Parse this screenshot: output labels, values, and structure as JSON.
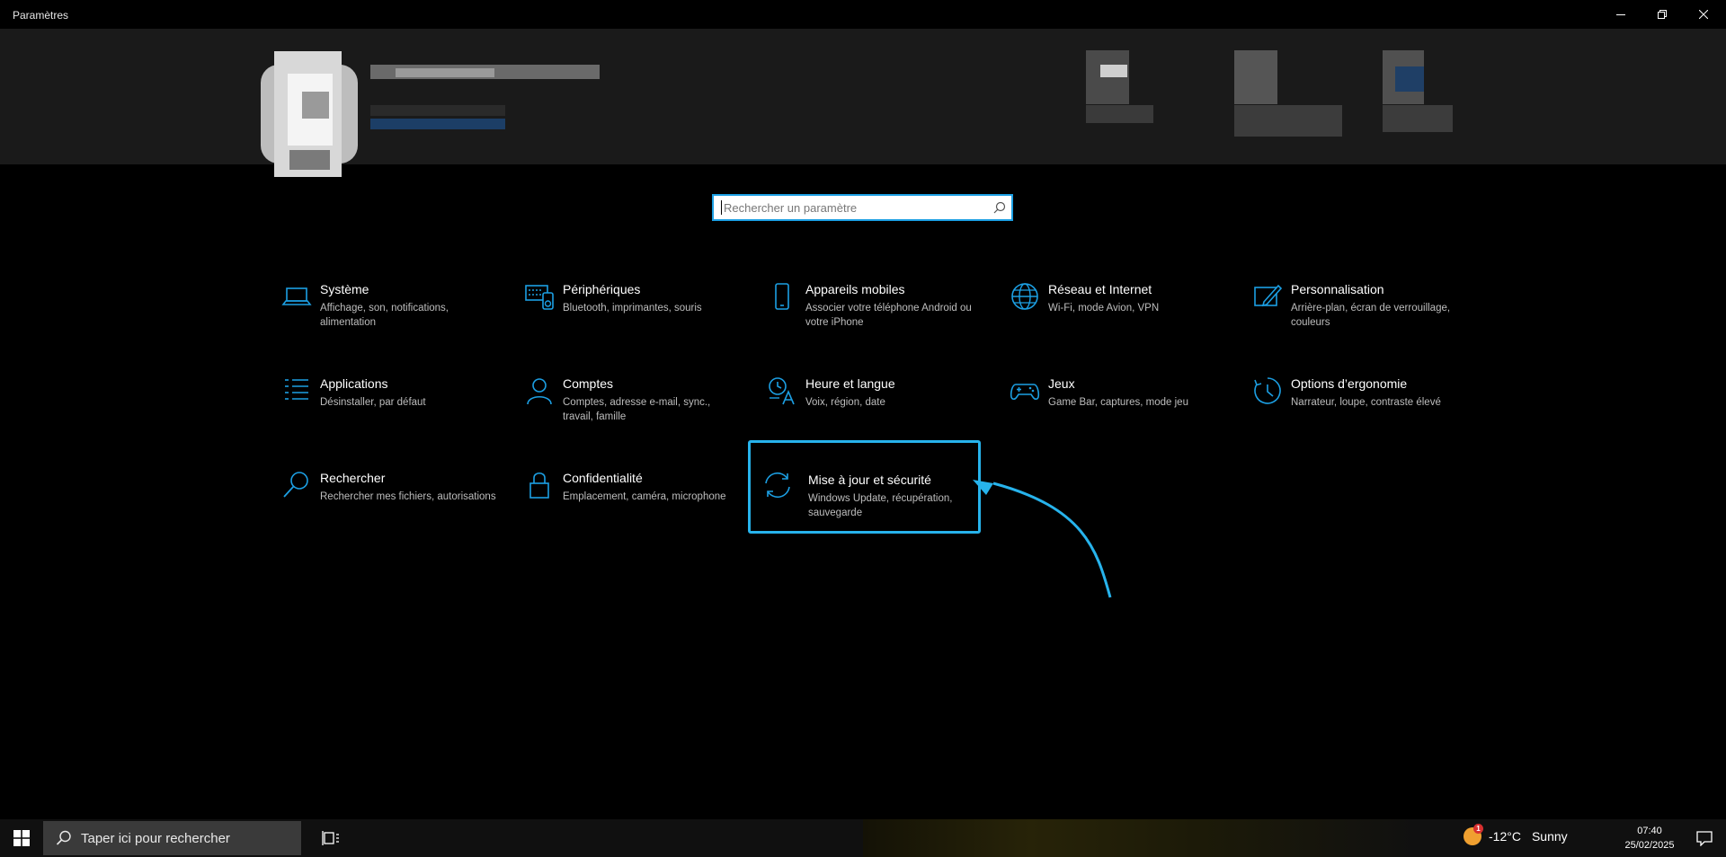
{
  "window": {
    "title": "Paramètres"
  },
  "search": {
    "placeholder": "Rechercher un paramètre"
  },
  "accent_color": "#1c9fe3",
  "highlight_color": "#27b3ec",
  "categories": [
    {
      "title": "Système",
      "desc": "Affichage, son, notifications, alimentation",
      "icon": "laptop-icon"
    },
    {
      "title": "Périphériques",
      "desc": "Bluetooth, imprimantes, souris",
      "icon": "devices-icon"
    },
    {
      "title": "Appareils mobiles",
      "desc": "Associer votre téléphone Android ou votre iPhone",
      "icon": "phone-icon"
    },
    {
      "title": "Réseau et Internet",
      "desc": "Wi-Fi, mode Avion, VPN",
      "icon": "globe-icon"
    },
    {
      "title": "Personnalisation",
      "desc": "Arrière-plan, écran de verrouillage, couleurs",
      "icon": "pen-icon"
    },
    {
      "title": "Applications",
      "desc": "Désinstaller, par défaut",
      "icon": "apps-list-icon"
    },
    {
      "title": "Comptes",
      "desc": "Comptes, adresse e-mail, sync., travail, famille",
      "icon": "person-icon"
    },
    {
      "title": "Heure et langue",
      "desc": "Voix, région, date",
      "icon": "time-language-icon"
    },
    {
      "title": "Jeux",
      "desc": "Game Bar, captures, mode jeu",
      "icon": "gamepad-icon"
    },
    {
      "title": "Options d’ergonomie",
      "desc": "Narrateur, loupe, contraste élevé",
      "icon": "ease-of-access-icon"
    },
    {
      "title": "Rechercher",
      "desc": "Rechercher mes fichiers, autorisations",
      "icon": "search-icon"
    },
    {
      "title": "Confidentialité",
      "desc": "Emplacement, caméra, microphone",
      "icon": "lock-icon"
    },
    {
      "title": "Mise à jour et sécurité",
      "desc": "Windows Update, récupération, sauvegarde",
      "icon": "sync-icon"
    }
  ],
  "taskbar": {
    "search_placeholder": "Taper ici pour rechercher",
    "weather_temp": "-12°C",
    "weather_cond": "Sunny",
    "weather_badge": "1",
    "time": "07:40",
    "date": "25/02/2025"
  }
}
